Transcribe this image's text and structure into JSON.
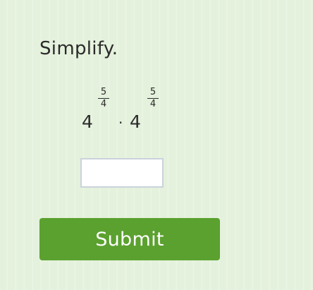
{
  "prompt": "Simplify.",
  "expression": {
    "term1": {
      "base": "4",
      "exponent_numerator": "5",
      "exponent_denominator": "4"
    },
    "operator": "·",
    "term2": {
      "base": "4",
      "exponent_numerator": "5",
      "exponent_denominator": "4"
    }
  },
  "answer": {
    "value": "",
    "placeholder": ""
  },
  "submit_label": "Submit",
  "colors": {
    "background": "#e4f1dc",
    "submit_button": "#5ba12f",
    "submit_text": "#ffffff",
    "text": "#2b2b2b",
    "input_border": "#c9d3dc"
  }
}
